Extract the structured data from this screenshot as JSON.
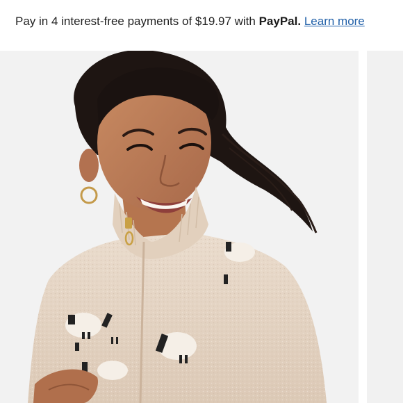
{
  "banner": {
    "prefix": "Pay in 4 interest-free payments of ",
    "amount": "$19.97",
    "with": " with ",
    "brand": "PayPal.",
    "learn_more": "Learn more"
  },
  "colors": {
    "link": "#1f5fa8",
    "photo_background": "#f2f2f2",
    "sweater": "#e6d6c6"
  },
  "icons": {
    "brand": "paypal-wordmark"
  }
}
